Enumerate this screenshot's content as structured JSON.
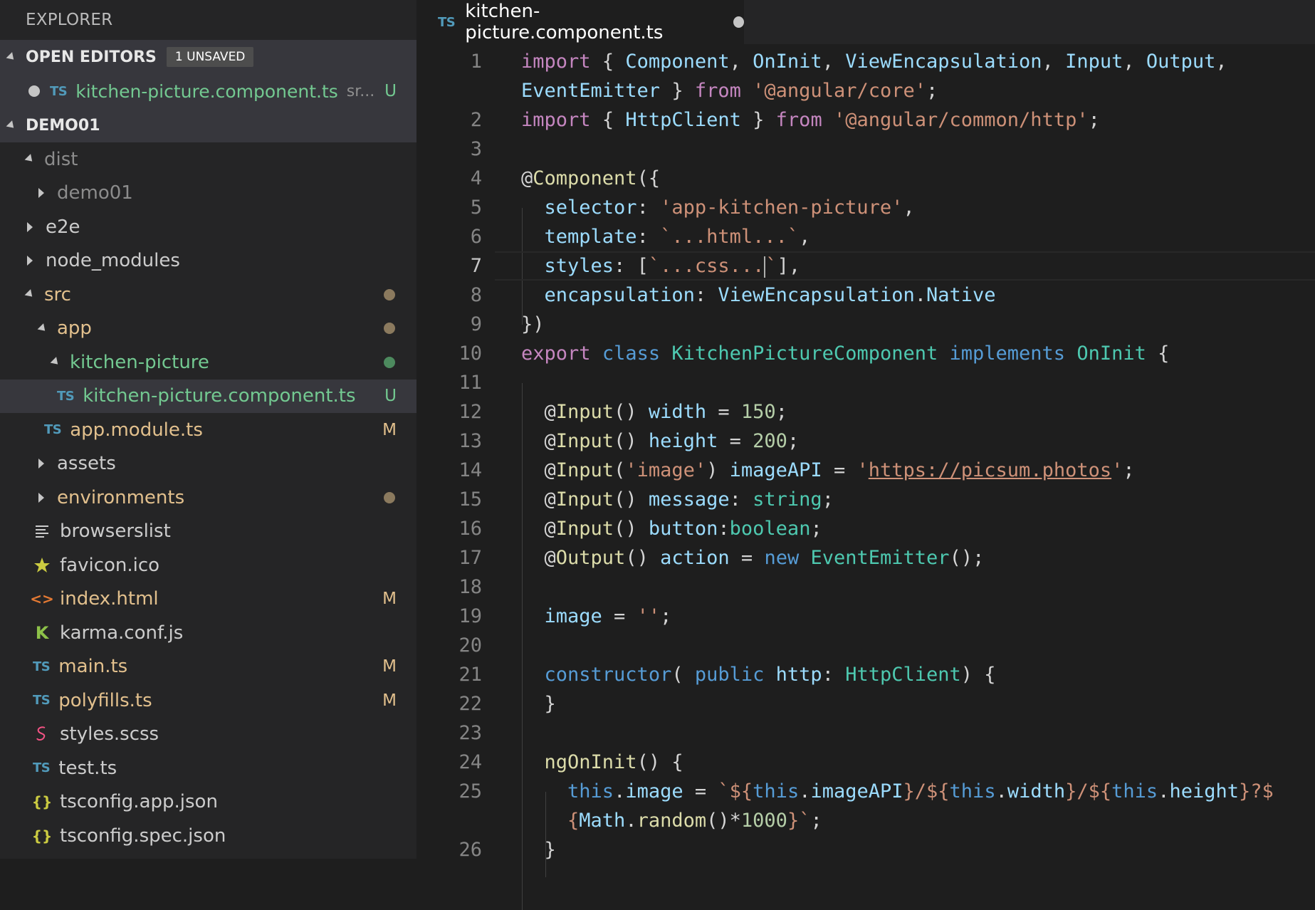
{
  "sidebar": {
    "title": "EXPLORER",
    "open_editors": {
      "label": "OPEN EDITORS",
      "badge": "1 UNSAVED",
      "file": {
        "icon": "TS",
        "name": "kitchen-picture.component.ts",
        "desc": "sr...",
        "status": "U"
      }
    },
    "project": {
      "label": "DEMO01"
    },
    "tree": [
      {
        "label": "dist",
        "icon": "TS"
      },
      {
        "label": "demo01"
      },
      {
        "label": "e2e"
      },
      {
        "label": "node_modules"
      },
      {
        "label": "src"
      },
      {
        "label": "app"
      },
      {
        "label": "kitchen-picture"
      },
      {
        "label": "kitchen-picture.component.ts",
        "icon": "TS",
        "status": "U"
      },
      {
        "label": "app.module.ts",
        "icon": "TS",
        "status": "M"
      },
      {
        "label": "assets"
      },
      {
        "label": "environments"
      },
      {
        "label": "browserslist",
        "icon": "lines-icon"
      },
      {
        "label": "favicon.ico",
        "icon": "star-icon"
      },
      {
        "label": "index.html",
        "icon": "<>",
        "status": "M"
      },
      {
        "label": "karma.conf.js",
        "icon": "K"
      },
      {
        "label": "main.ts",
        "icon": "TS",
        "status": "M"
      },
      {
        "label": "polyfills.ts",
        "icon": "TS",
        "status": "M"
      },
      {
        "label": "styles.scss",
        "icon": "sass-icon"
      },
      {
        "label": "test.ts",
        "icon": "TS"
      },
      {
        "label": "tsconfig.app.json",
        "icon": "{}"
      },
      {
        "label": "tsconfig.spec.json",
        "icon": "{}"
      }
    ]
  },
  "editor": {
    "tab": {
      "icon": "TS",
      "label": "kitchen-picture.component.ts"
    },
    "line_numbers": [
      "1",
      "",
      "2",
      "3",
      "4",
      "5",
      "6",
      "7",
      "8",
      "9",
      "10",
      "11",
      "12",
      "13",
      "14",
      "15",
      "16",
      "17",
      "18",
      "19",
      "20",
      "21",
      "22",
      "23",
      "24",
      "25",
      "",
      "26"
    ],
    "active_line": "7"
  },
  "colors": {
    "modified": "#e2c08d",
    "untracked": "#73c991",
    "keyword": "#c586c0",
    "string": "#ce9178"
  }
}
